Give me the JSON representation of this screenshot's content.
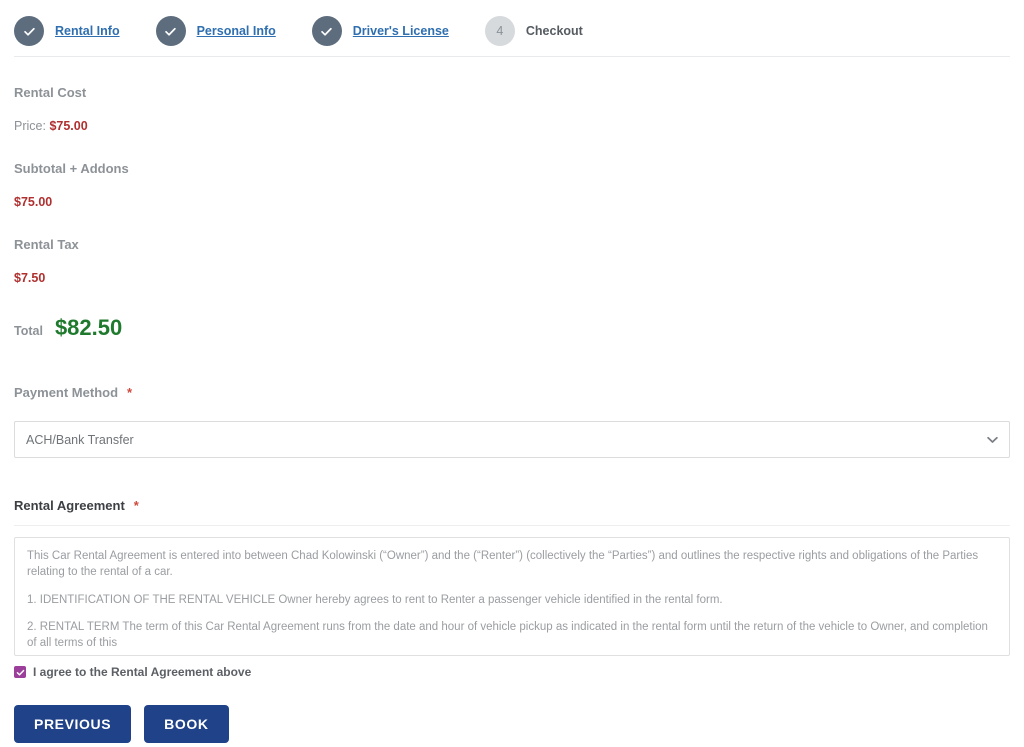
{
  "stepper": {
    "steps": [
      {
        "label": "Rental Info",
        "state": "done",
        "marker": "check"
      },
      {
        "label": "Personal Info",
        "state": "done",
        "marker": "check"
      },
      {
        "label": "Driver's License",
        "state": "done",
        "marker": "check"
      },
      {
        "label": "Checkout",
        "state": "current",
        "marker": "4"
      }
    ]
  },
  "pricing": {
    "rental_cost_heading": "Rental Cost",
    "price_label": "Price:",
    "price_value": "$75.00",
    "subtotal_heading": "Subtotal + Addons",
    "subtotal_value": "$75.00",
    "tax_heading": "Rental Tax",
    "tax_value": "$7.50",
    "total_label": "Total",
    "total_value": "$82.50"
  },
  "payment": {
    "label": "Payment Method",
    "required_mark": "*",
    "selected": "ACH/Bank Transfer",
    "options": [
      "ACH/Bank Transfer"
    ]
  },
  "agreement": {
    "label": "Rental Agreement",
    "required_mark": "*",
    "paragraphs": [
      "This Car Rental Agreement is entered into between Chad Kolowinski (“Owner”) and the (“Renter”) (collectively the “Parties”) and outlines the respective rights and obligations of the Parties relating to the rental of a car.",
      "1. IDENTIFICATION OF THE RENTAL VEHICLE\nOwner hereby agrees to rent to Renter a passenger vehicle identified in the rental form.",
      "2. RENTAL TERM\nThe term of this Car Rental Agreement runs from the date and hour of vehicle pickup as indicated in the rental form until the return of the vehicle to Owner, and completion of all terms of this"
    ],
    "consent_label": "I agree to the Rental Agreement above",
    "consent_checked": true
  },
  "actions": {
    "previous_label": "PREVIOUS",
    "book_label": "BOOK"
  },
  "colors": {
    "accent_blue": "#2f6fb0",
    "button_navy": "#1f4288",
    "price_red": "#b03030",
    "total_green": "#1f7a2e",
    "checkbox_purple": "#9b3f9b",
    "step_done": "#5d6d7e",
    "step_todo": "#d6dadd",
    "required_red": "#d0493b"
  }
}
